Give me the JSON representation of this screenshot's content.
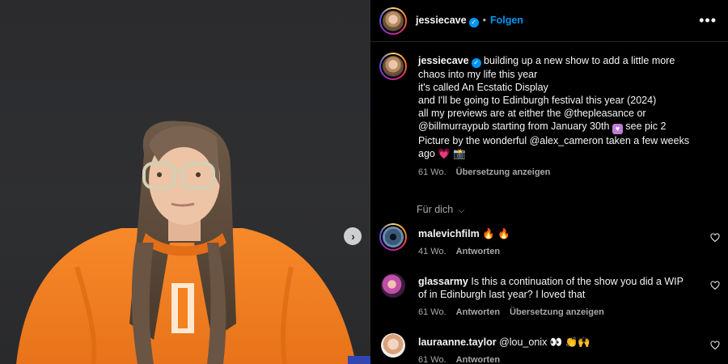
{
  "header": {
    "username": "jessiecave",
    "follow_label": "Folgen",
    "more_icon": "more-horizontal-icon"
  },
  "caption": {
    "username": "jessiecave",
    "lines": [
      "building up a new show to add a little more",
      "chaos into my life this year",
      "it's called An Ecstatic Display",
      "and I'll be going to Edinburgh festival this year (2024)",
      "all my previews are at either the @thepleasance or",
      "@billmurraypub starting from January 30th",
      "see pic 2",
      "Picture by the wonderful @alex_cameron taken a few weeks",
      "ago"
    ],
    "time": "61 Wo.",
    "translate": "Übersetzung anzeigen"
  },
  "for_you_label": "Für dich",
  "comments": [
    {
      "username": "malevichfilm",
      "text": "🔥 🔥",
      "time": "41 Wo.",
      "reply": "Antworten"
    },
    {
      "username": "glassarmy",
      "text_line1": "Is this a continuation of the show you did a WIP",
      "text_line2": "of in Edinburgh last year? I loved that",
      "time": "61 Wo.",
      "reply": "Antworten",
      "translate": "Übersetzung anzeigen"
    },
    {
      "username": "lauraanne.taylor",
      "text": "@lou_onix 👀 👏🙌",
      "time": "61 Wo.",
      "reply": "Antworten"
    }
  ],
  "colors": {
    "accent_blue": "#0095f6",
    "muted_text": "#a8a8a8",
    "background": "#000000",
    "sweater_orange": "#f5821f"
  },
  "icons": {
    "next": "chevron-right-icon",
    "heart": "heart-outline-icon",
    "verified": "verified-badge-icon"
  }
}
